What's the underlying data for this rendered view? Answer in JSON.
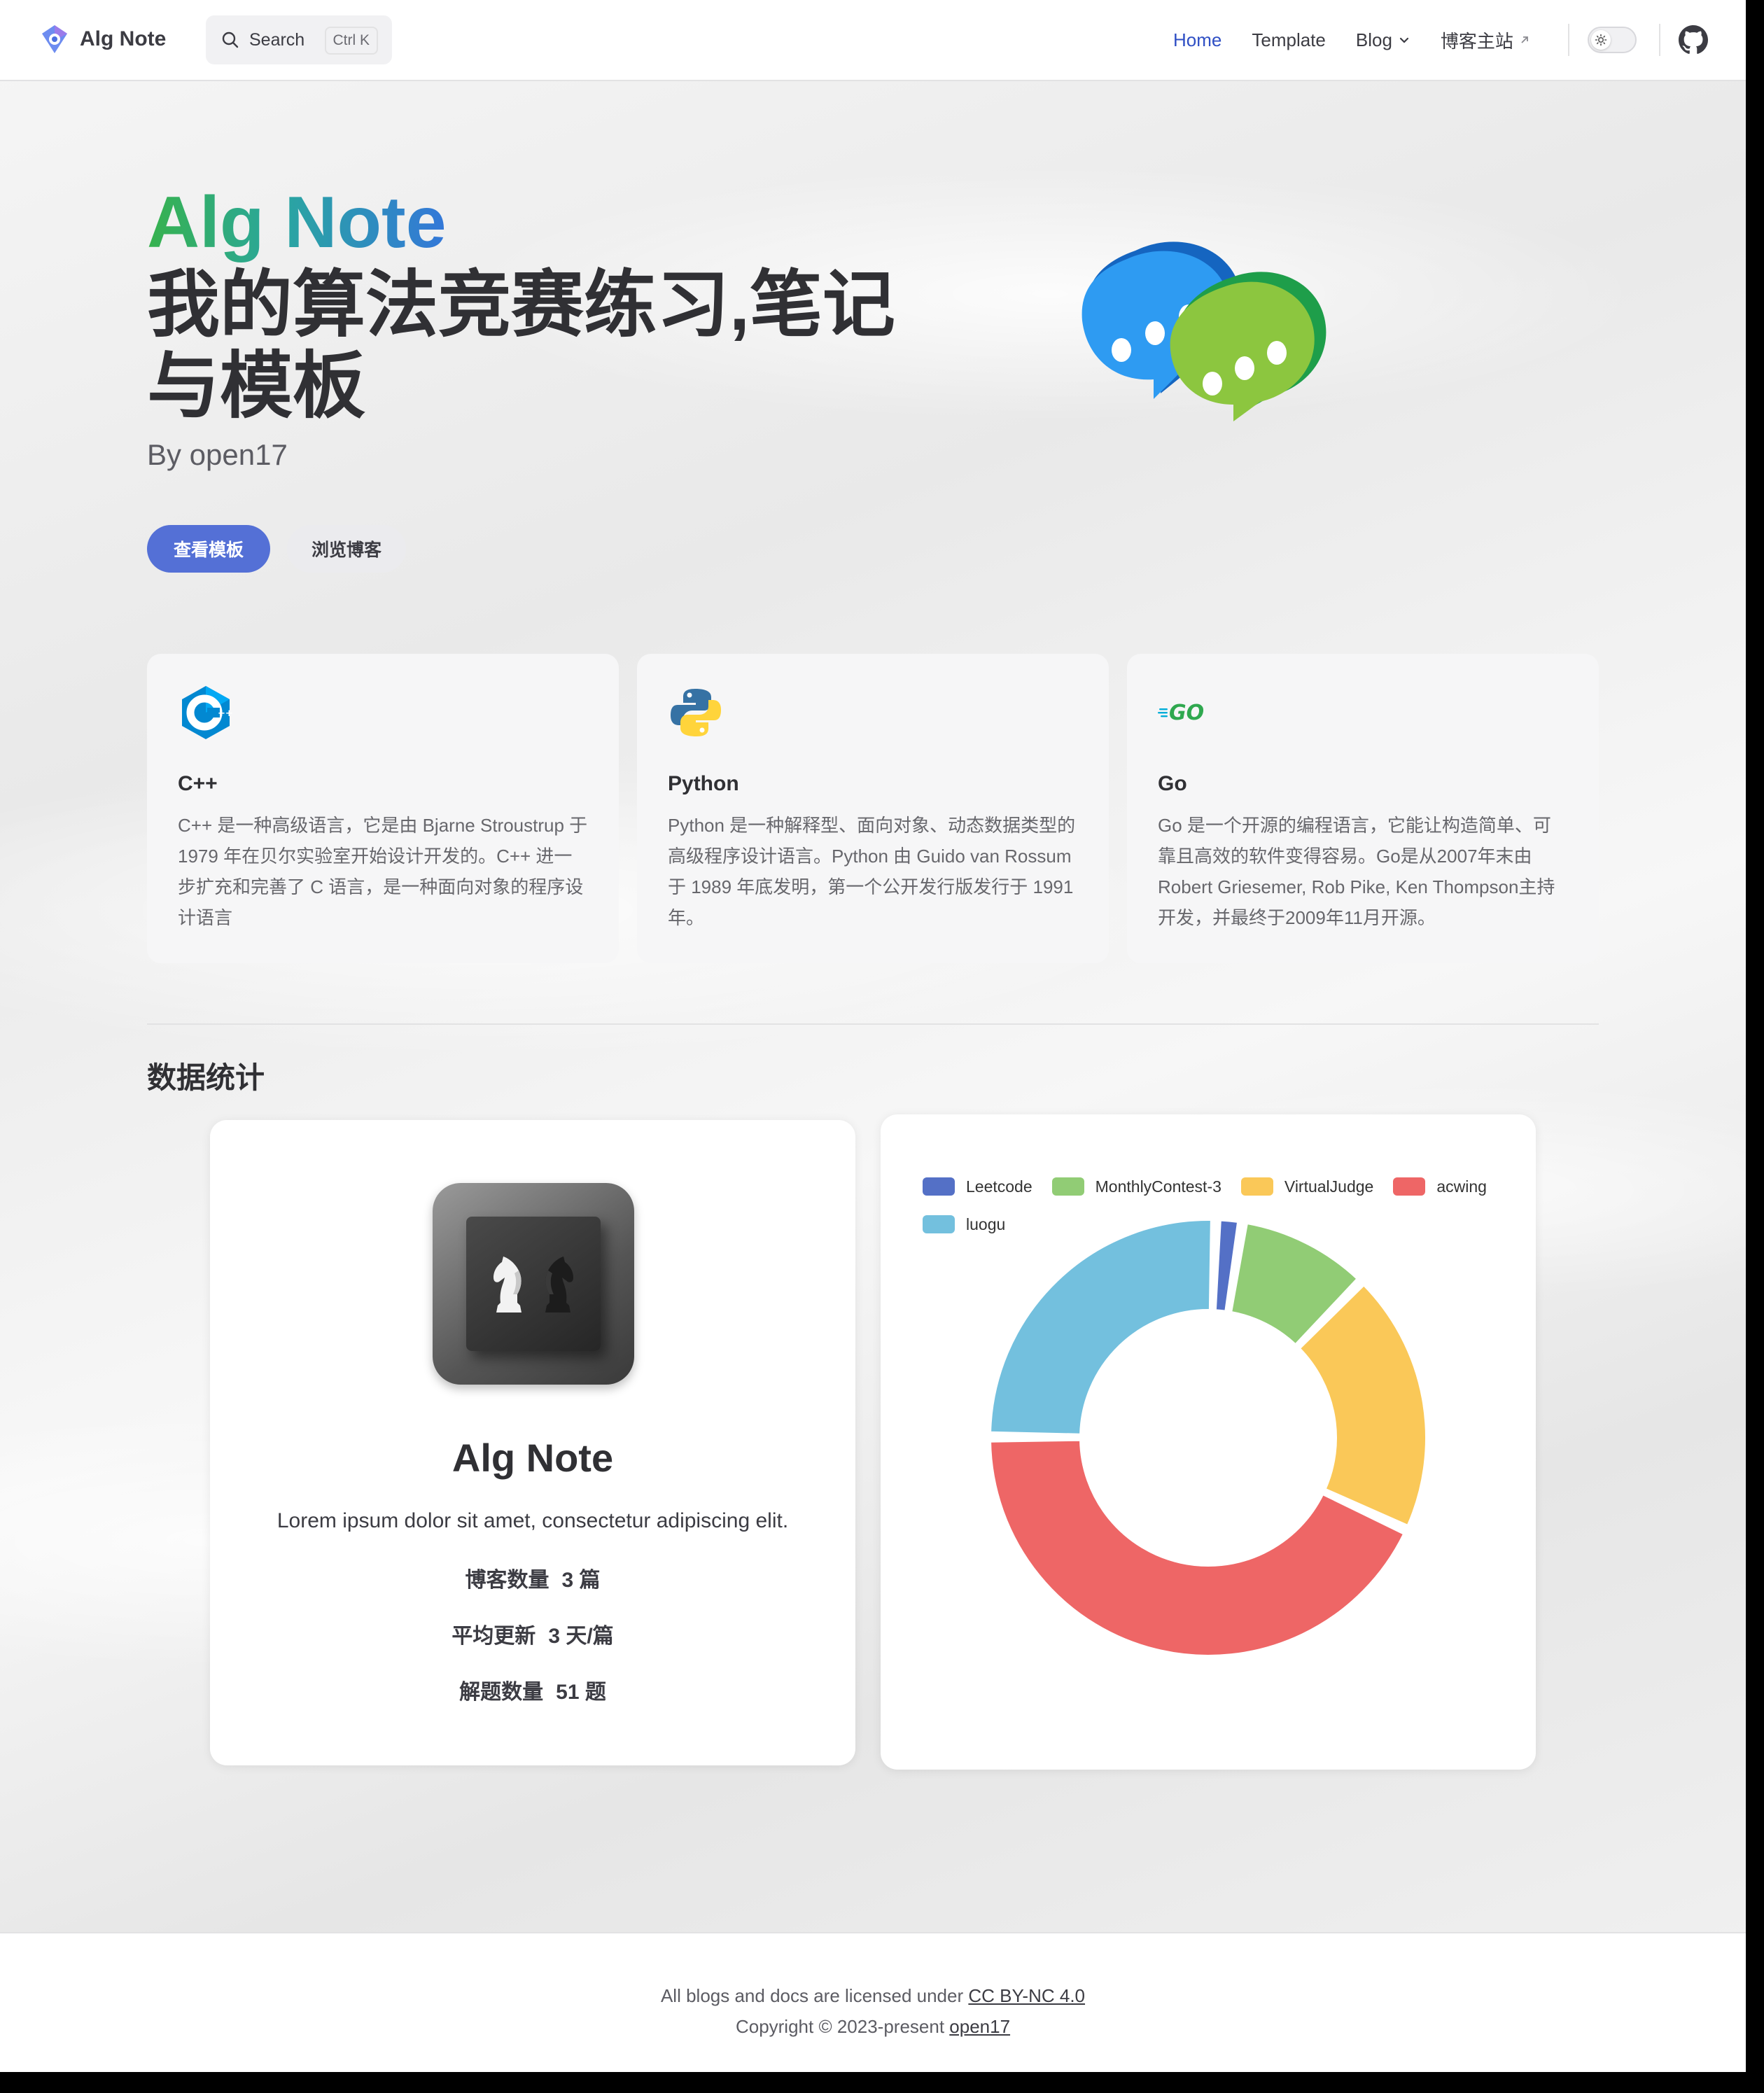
{
  "nav": {
    "brand": "Alg Note",
    "search_label": "Search",
    "search_shortcut": "Ctrl K",
    "links": [
      "Home",
      "Template",
      "Blog",
      "博客主站"
    ]
  },
  "hero": {
    "name": "Alg Note",
    "text": "我的算法竞赛练习,笔记与模板",
    "tagline": "By open17",
    "actions": [
      "查看模板",
      "浏览博客"
    ]
  },
  "features": [
    {
      "icon": "cpp-icon",
      "title": "C++",
      "details": "C++ 是一种高级语言，它是由 Bjarne Stroustrup 于 1979 年在贝尔实验室开始设计开发的。C++ 进一步扩充和完善了 C 语言，是一种面向对象的程序设计语言"
    },
    {
      "icon": "python-icon",
      "title": "Python",
      "details": "Python 是一种解释型、面向对象、动态数据类型的高级程序设计语言。Python 由 Guido van Rossum 于 1989 年底发明，第一个公开发行版发行于 1991 年。"
    },
    {
      "icon": "go-icon",
      "title": "Go",
      "details": "Go 是一个开源的编程语言，它能让构造简单、可靠且高效的软件变得容易。Go是从2007年末由Robert Griesemer, Rob Pike, Ken Thompson主持开发，并最终于2009年11月开源。"
    }
  ],
  "stats_section": {
    "title": "数据统计",
    "profile": {
      "name": "Alg Note",
      "description": "Lorem ipsum dolor sit amet, consectetur adipiscing elit.",
      "stats": [
        {
          "label": "博客数量",
          "value": "3 篇"
        },
        {
          "label": "平均更新",
          "value": "3 天/篇"
        },
        {
          "label": "解题数量",
          "value": "51 题"
        }
      ]
    }
  },
  "chart_data": {
    "type": "pie",
    "variant": "donut",
    "series": [
      {
        "name": "Leetcode",
        "value": 1,
        "color": "#5470c6"
      },
      {
        "name": "MonthlyContest-3",
        "value": 5,
        "color": "#91cc75"
      },
      {
        "name": "VirtualJudge",
        "value": 10,
        "color": "#fac858"
      },
      {
        "name": "acwing",
        "value": 22,
        "color": "#ee6666"
      },
      {
        "name": "luogu",
        "value": 13,
        "color": "#73c0de"
      }
    ],
    "legend_position": "top"
  },
  "footer": {
    "license_prefix": "All blogs and docs are licensed under ",
    "license_link": "CC BY-NC 4.0",
    "copyright_prefix": "Copyright © 2023-present ",
    "copyright_link": "open17"
  },
  "colors": {
    "accent": "#5470d6",
    "active_link": "#2f4fc4"
  }
}
